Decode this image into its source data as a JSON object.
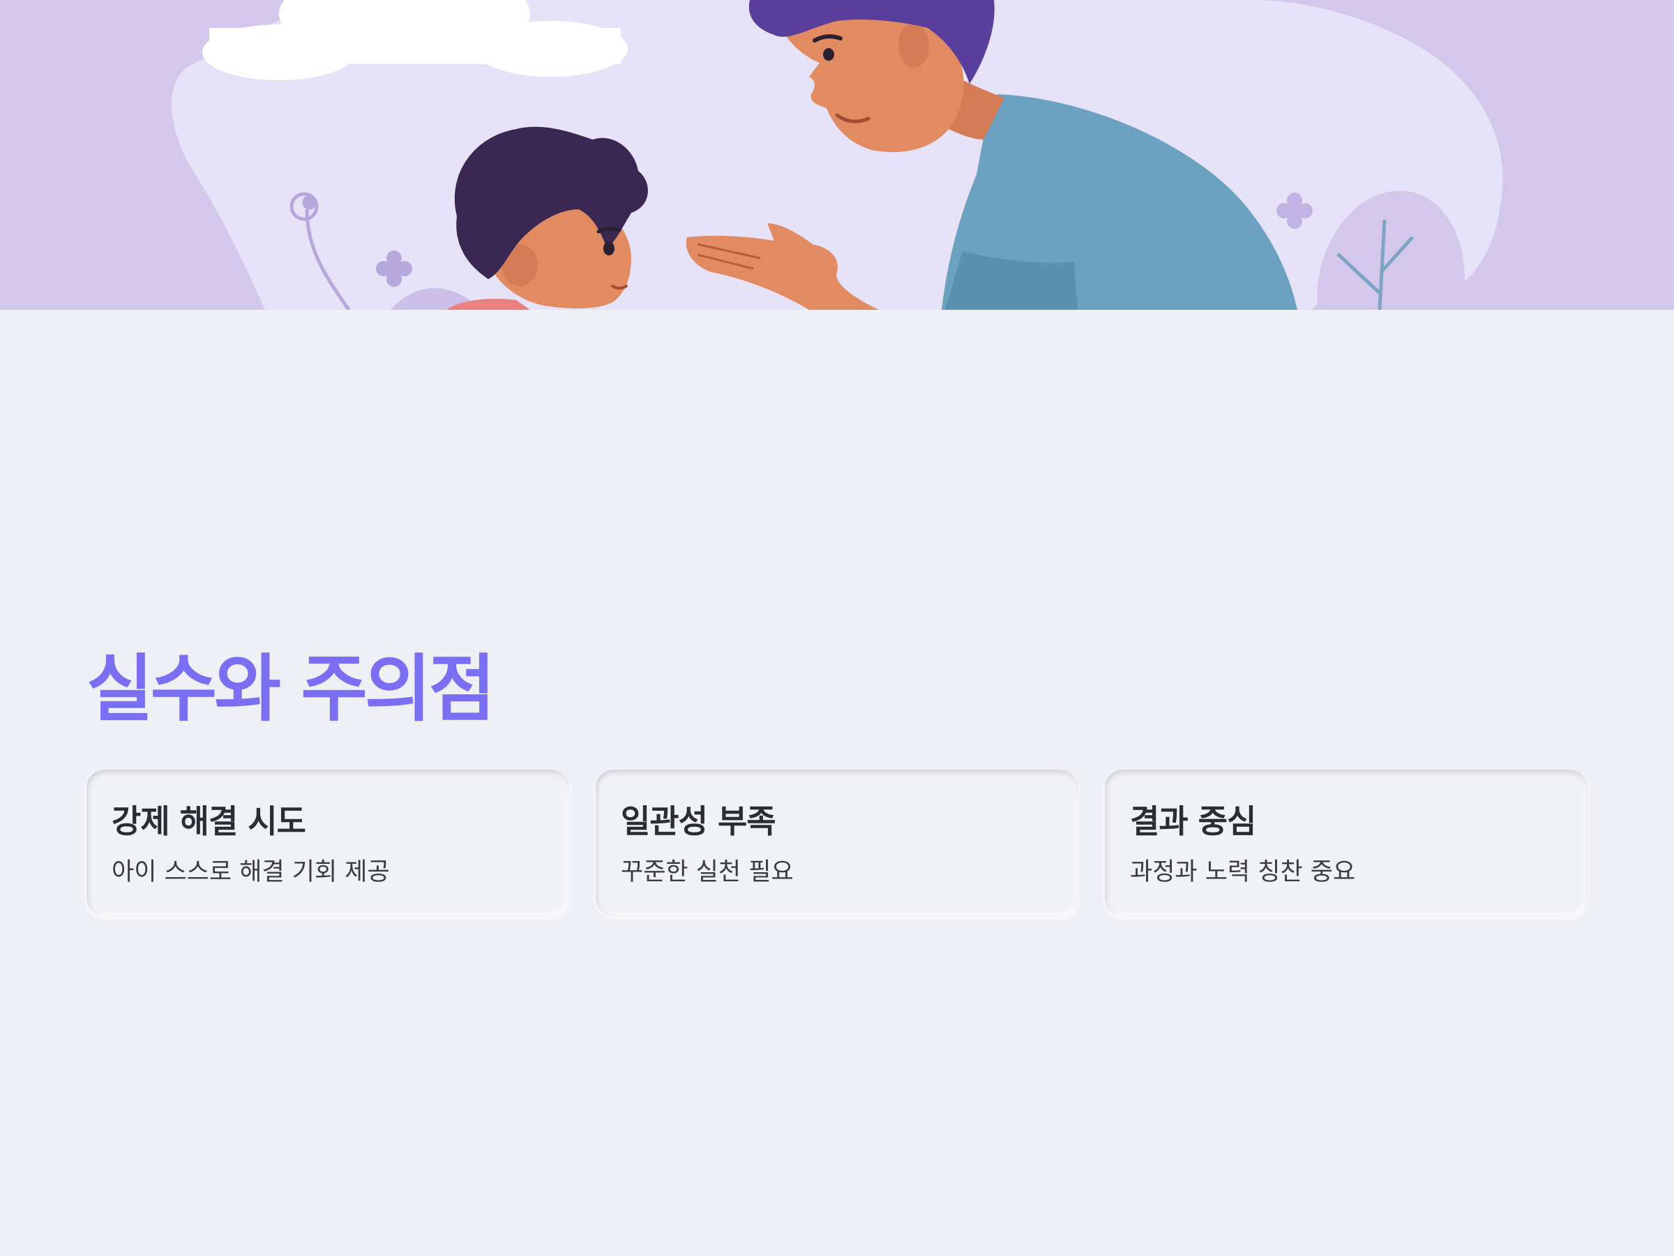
{
  "hero": {
    "illustration": "parent-and-child-illustration",
    "colors": {
      "background": "#d3c8ec",
      "blob": "#e6e2f7",
      "shirt": "#6ca1c2",
      "skin": "#e28b63",
      "hair_parent": "#5a3e9c",
      "hair_child": "#3a2752"
    }
  },
  "section": {
    "title": "실수와 주의점",
    "title_color": "#7a6ef2"
  },
  "cards": [
    {
      "title": "강제 해결 시도",
      "description": "아이 스스로 해결 기회 제공"
    },
    {
      "title": "일관성 부족",
      "description": "꾸준한 실천 필요"
    },
    {
      "title": "결과 중심",
      "description": "과정과 노력 칭찬 중요"
    }
  ],
  "page": {
    "background": "#eff0f5"
  }
}
